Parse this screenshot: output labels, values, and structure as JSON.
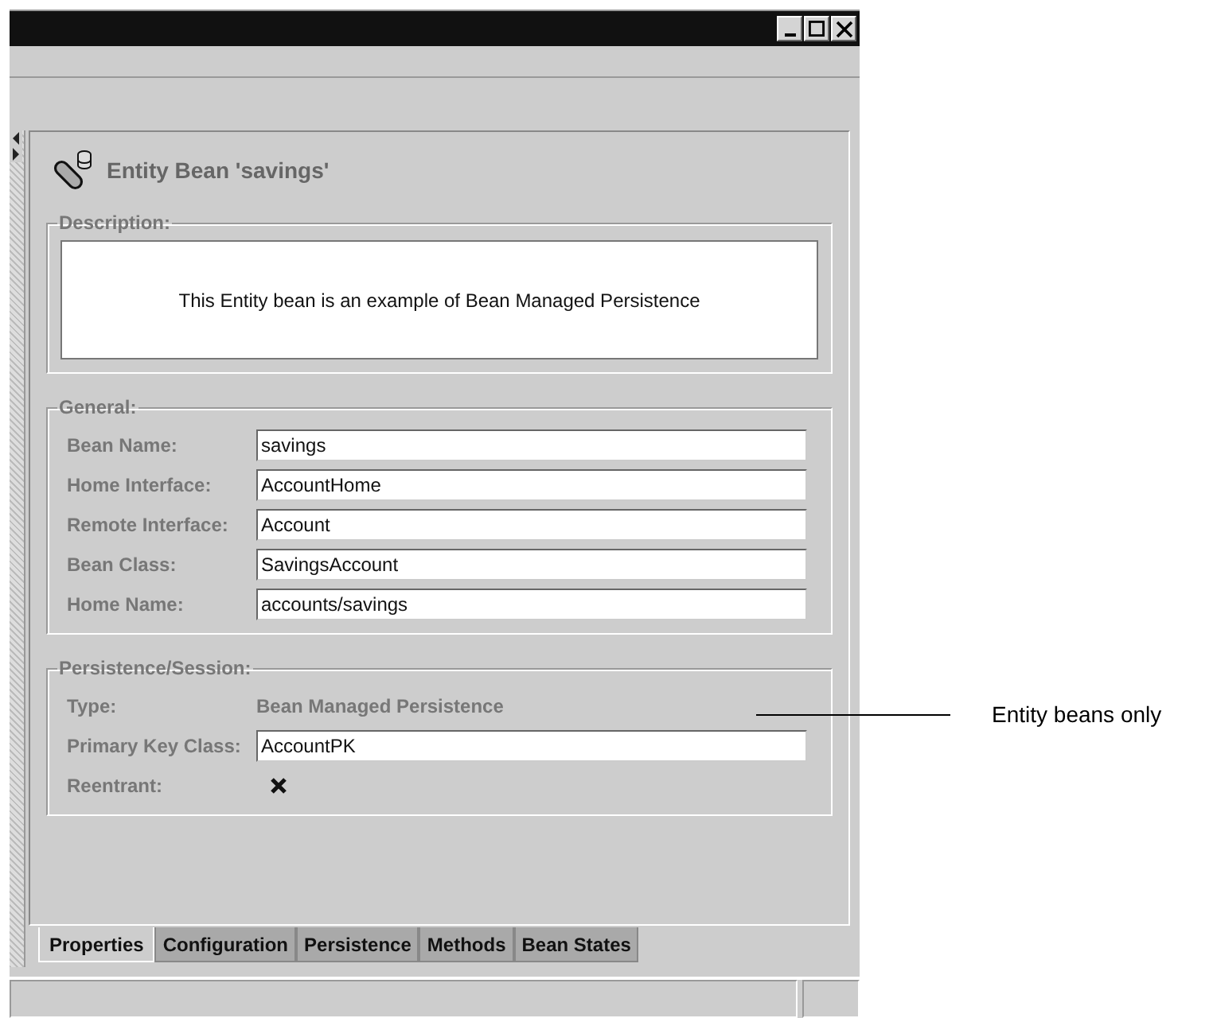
{
  "window": {
    "buttons": [
      {
        "kind": "minimize"
      },
      {
        "kind": "maximize"
      },
      {
        "kind": "close"
      }
    ]
  },
  "header": {
    "title": "Entity Bean 'savings'"
  },
  "description": {
    "label": "Description:",
    "text": "This Entity bean is an example of Bean Managed Persistence"
  },
  "general": {
    "label": "General:",
    "fields": [
      {
        "label": "Bean Name:",
        "value": "savings"
      },
      {
        "label": "Home Interface:",
        "value": "AccountHome"
      },
      {
        "label": "Remote Interface:",
        "value": "Account"
      },
      {
        "label": "Bean Class:",
        "value": "SavingsAccount"
      },
      {
        "label": "Home Name:",
        "value": "accounts/savings"
      }
    ]
  },
  "persistence": {
    "label": "Persistence/Session:",
    "rows": [
      {
        "kind": "text",
        "label": "Type:",
        "value": "Bean Managed Persistence"
      },
      {
        "kind": "field",
        "label": "Primary Key Class:",
        "value": "AccountPK"
      },
      {
        "kind": "check",
        "label": "Reentrant:",
        "checked": true
      }
    ]
  },
  "tabs": [
    {
      "label": "Properties",
      "selected": true
    },
    {
      "label": "Configuration",
      "selected": false
    },
    {
      "label": "Persistence",
      "selected": false
    },
    {
      "label": "Methods",
      "selected": false
    },
    {
      "label": "Bean States",
      "selected": false
    }
  ],
  "annotation": {
    "text": "Entity beans only"
  }
}
